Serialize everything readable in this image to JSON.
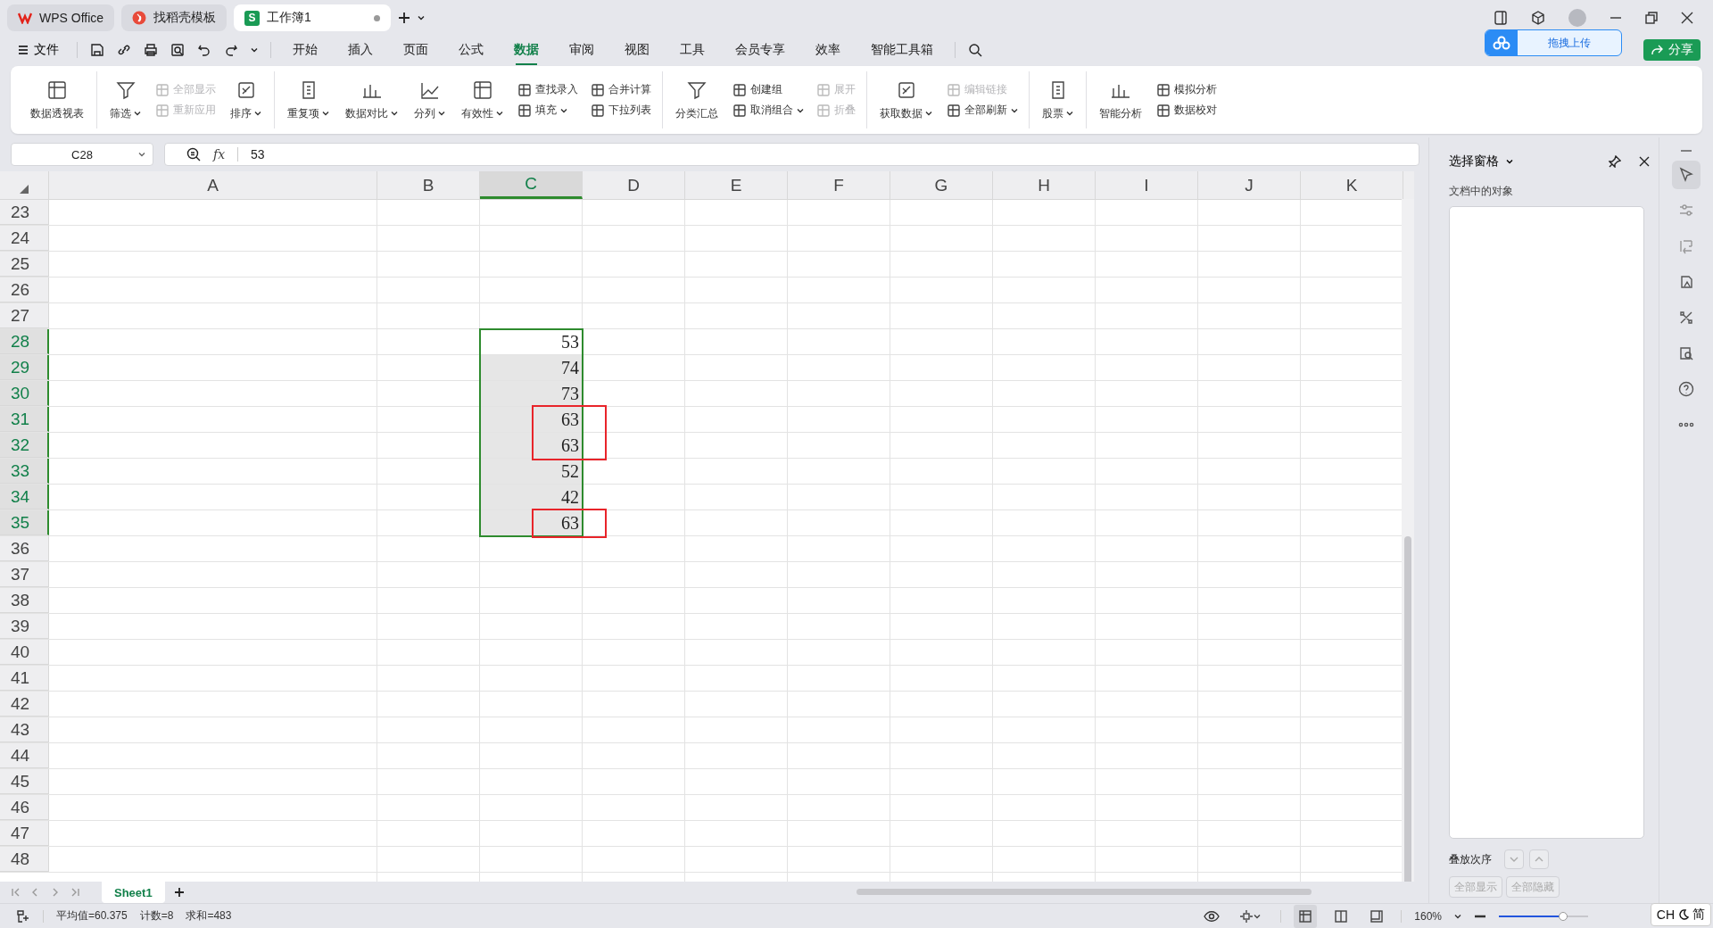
{
  "tabs": [
    {
      "kind": "home",
      "label": "WPS Office",
      "selected": false
    },
    {
      "kind": "template",
      "label": "找稻壳模板",
      "selected": false
    },
    {
      "kind": "sheet",
      "badge": "S",
      "label": "工作簿1",
      "selected": true,
      "unsaved": true
    }
  ],
  "menu": {
    "file": "文件",
    "tabs": [
      {
        "label": "开始",
        "selected": false
      },
      {
        "label": "插入",
        "selected": false
      },
      {
        "label": "页面",
        "selected": false
      },
      {
        "label": "公式",
        "selected": false
      },
      {
        "label": "数据",
        "selected": true
      },
      {
        "label": "审阅",
        "selected": false
      },
      {
        "label": "视图",
        "selected": false
      },
      {
        "label": "工具",
        "selected": false
      },
      {
        "label": "会员专享",
        "selected": false
      },
      {
        "label": "效率",
        "selected": false
      },
      {
        "label": "智能工具箱",
        "selected": false
      }
    ],
    "upload_button": "拖拽上传",
    "share_button": "分享"
  },
  "ribbon": {
    "groups": [
      [
        {
          "kind": "large",
          "label": "数据透视表",
          "dropdown": false,
          "disabled": false
        }
      ],
      [
        {
          "kind": "large",
          "label": "筛选",
          "dropdown": true,
          "disabled": false
        },
        {
          "kind": "stack",
          "buttons": [
            {
              "label": "全部显示",
              "dropdown": false,
              "disabled": true
            },
            {
              "label": "重新应用",
              "dropdown": false,
              "disabled": true
            }
          ]
        },
        {
          "kind": "large",
          "label": "排序",
          "dropdown": true,
          "disabled": false
        }
      ],
      [
        {
          "kind": "large",
          "label": "重复项",
          "dropdown": true,
          "disabled": false
        },
        {
          "kind": "large",
          "label": "数据对比",
          "dropdown": true,
          "disabled": false
        },
        {
          "kind": "large",
          "label": "分列",
          "dropdown": true,
          "disabled": false
        },
        {
          "kind": "large",
          "label": "有效性",
          "dropdown": true,
          "disabled": false
        },
        {
          "kind": "stack",
          "buttons": [
            {
              "label": "查找录入",
              "dropdown": false,
              "disabled": false
            },
            {
              "label": "填充",
              "dropdown": true,
              "disabled": false
            }
          ]
        },
        {
          "kind": "stack",
          "buttons": [
            {
              "label": "合并计算",
              "dropdown": false,
              "disabled": false
            },
            {
              "label": "下拉列表",
              "dropdown": false,
              "disabled": false
            }
          ]
        }
      ],
      [
        {
          "kind": "large",
          "label": "分类汇总",
          "dropdown": false,
          "disabled": false
        },
        {
          "kind": "stack",
          "buttons": [
            {
              "label": "创建组",
              "dropdown": false,
              "disabled": false
            },
            {
              "label": "取消组合",
              "dropdown": true,
              "disabled": false
            }
          ]
        },
        {
          "kind": "stack",
          "buttons": [
            {
              "label": "展开",
              "dropdown": false,
              "disabled": true
            },
            {
              "label": "折叠",
              "dropdown": false,
              "disabled": true
            }
          ]
        }
      ],
      [
        {
          "kind": "large",
          "label": "获取数据",
          "dropdown": true,
          "disabled": false
        },
        {
          "kind": "stack",
          "buttons": [
            {
              "label": "编辑链接",
              "dropdown": false,
              "disabled": true
            },
            {
              "label": "全部刷新",
              "dropdown": true,
              "disabled": false
            }
          ]
        }
      ],
      [
        {
          "kind": "large",
          "label": "股票",
          "dropdown": true,
          "disabled": false
        }
      ],
      [
        {
          "kind": "large",
          "label": "智能分析",
          "dropdown": false,
          "disabled": false
        },
        {
          "kind": "stack",
          "buttons": [
            {
              "label": "模拟分析",
              "dropdown": false,
              "disabled": false
            },
            {
              "label": "数据校对",
              "dropdown": false,
              "disabled": false
            }
          ]
        }
      ]
    ]
  },
  "formula_bar": {
    "cell_ref": "C28",
    "fx": "fx",
    "value": "53"
  },
  "columns": [
    {
      "label": "A",
      "selected": false
    },
    {
      "label": "B",
      "selected": false
    },
    {
      "label": "C",
      "selected": true
    },
    {
      "label": "D",
      "selected": false
    },
    {
      "label": "E",
      "selected": false
    },
    {
      "label": "F",
      "selected": false
    },
    {
      "label": "G",
      "selected": false
    },
    {
      "label": "H",
      "selected": false
    },
    {
      "label": "I",
      "selected": false
    },
    {
      "label": "J",
      "selected": false
    },
    {
      "label": "K",
      "selected": false
    }
  ],
  "rows": [
    {
      "number": "23",
      "selected": false
    },
    {
      "number": "24",
      "selected": false
    },
    {
      "number": "25",
      "selected": false
    },
    {
      "number": "26",
      "selected": false
    },
    {
      "number": "27",
      "selected": false
    },
    {
      "number": "28",
      "selected": true,
      "active": true,
      "column_c": "53",
      "marked": false
    },
    {
      "number": "29",
      "selected": true,
      "active": false,
      "column_c": "74",
      "marked": false
    },
    {
      "number": "30",
      "selected": true,
      "active": false,
      "column_c": "73",
      "marked": false
    },
    {
      "number": "31",
      "selected": true,
      "active": false,
      "column_c": "63",
      "marked": true
    },
    {
      "number": "32",
      "selected": true,
      "active": false,
      "column_c": "63",
      "marked": true
    },
    {
      "number": "33",
      "selected": true,
      "active": false,
      "column_c": "52",
      "marked": false
    },
    {
      "number": "34",
      "selected": true,
      "active": false,
      "column_c": "42",
      "marked": false
    },
    {
      "number": "35",
      "selected": true,
      "active": false,
      "column_c": "63",
      "marked": true
    },
    {
      "number": "36",
      "selected": false
    },
    {
      "number": "37",
      "selected": false
    },
    {
      "number": "38",
      "selected": false
    },
    {
      "number": "39",
      "selected": false
    },
    {
      "number": "40",
      "selected": false
    },
    {
      "number": "41",
      "selected": false
    },
    {
      "number": "42",
      "selected": false
    },
    {
      "number": "43",
      "selected": false
    },
    {
      "number": "44",
      "selected": false
    },
    {
      "number": "45",
      "selected": false
    },
    {
      "number": "46",
      "selected": false
    },
    {
      "number": "47",
      "selected": false
    },
    {
      "number": "48",
      "selected": false
    }
  ],
  "sheets": [
    {
      "label": "Sheet1",
      "selected": true
    }
  ],
  "selection_pane": {
    "title": "选择窗格",
    "objects_label": "文档中的对象",
    "order_label": "叠放次序",
    "show_all": "全部显示",
    "hide_all": "全部隐藏"
  },
  "side_tools": [
    {
      "kind": "pointer",
      "selected": true
    },
    {
      "kind": "sliders",
      "selected": false
    },
    {
      "kind": "convert",
      "selected": false
    },
    {
      "kind": "image",
      "selected": false
    },
    {
      "kind": "tools",
      "selected": false
    },
    {
      "kind": "find",
      "selected": false
    },
    {
      "kind": "help",
      "selected": false
    },
    {
      "kind": "more",
      "selected": false
    }
  ],
  "status_bar": {
    "stats": [
      "平均值=60.375",
      "计数=8",
      "求和=483"
    ],
    "views": [
      {
        "kind": "normal",
        "selected": true
      },
      {
        "kind": "page",
        "selected": false
      },
      {
        "kind": "break",
        "selected": false
      }
    ],
    "zoom": "160%",
    "zoom_level": {
      "level": 0.72
    }
  },
  "ime": {
    "mode": "CH",
    "script": "简"
  }
}
